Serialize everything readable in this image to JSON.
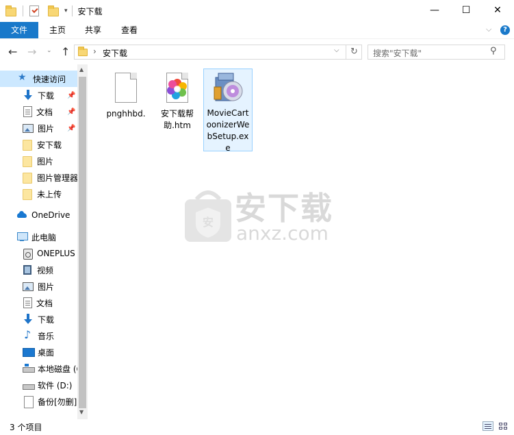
{
  "window": {
    "title": "安下载",
    "controls": {
      "minimize": "—",
      "maximize": "☐",
      "close": "✕"
    }
  },
  "ribbon": {
    "tabs": [
      {
        "label": "文件",
        "active": true
      },
      {
        "label": "主页"
      },
      {
        "label": "共享"
      },
      {
        "label": "查看"
      }
    ],
    "expand_icon": "chevron-down-icon",
    "help_icon": "help-icon"
  },
  "address": {
    "breadcrumb_sep": "›",
    "path": "安下载",
    "search_placeholder": "搜索\"安下载\""
  },
  "sidebar": {
    "items": [
      {
        "label": "快速访问",
        "icon": "star-icon",
        "selected": true
      },
      {
        "label": "下载",
        "icon": "download-icon",
        "pinned": true
      },
      {
        "label": "文档",
        "icon": "document-icon",
        "pinned": true
      },
      {
        "label": "图片",
        "icon": "pictures-icon",
        "pinned": true
      },
      {
        "label": "安下载",
        "icon": "folder-icon"
      },
      {
        "label": "图片",
        "icon": "folder-icon"
      },
      {
        "label": "图片管理器",
        "icon": "folder-icon"
      },
      {
        "label": "未上传",
        "icon": "folder-icon"
      },
      {
        "label": "OneDrive",
        "icon": "cloud-icon"
      },
      {
        "label": "此电脑",
        "icon": "computer-icon"
      },
      {
        "label": "ONEPLUS",
        "icon": "device-icon"
      },
      {
        "label": "视频",
        "icon": "video-icon"
      },
      {
        "label": "图片",
        "icon": "pictures-icon"
      },
      {
        "label": "文档",
        "icon": "document-icon"
      },
      {
        "label": "下载",
        "icon": "download-icon"
      },
      {
        "label": "音乐",
        "icon": "music-icon"
      },
      {
        "label": "桌面",
        "icon": "desktop-icon"
      },
      {
        "label": "本地磁盘 (C:)",
        "icon": "drive-icon"
      },
      {
        "label": "软件 (D:)",
        "icon": "drive-icon"
      },
      {
        "label": "备份[勿删]",
        "icon": "file-icon"
      }
    ]
  },
  "files": [
    {
      "name": "pnghhbd.",
      "icon": "blank-file-icon"
    },
    {
      "name": "安下载帮助.htm",
      "icon": "html-file-icon"
    },
    {
      "name": "MovieCartoonizerWebSetup.exe",
      "icon": "installer-icon",
      "selected": true
    }
  ],
  "watermark": {
    "text_cn": "安下载",
    "text_en": "anxz.com",
    "badge": "安"
  },
  "status": {
    "item_count": "3 个项目"
  },
  "colors": {
    "accent": "#1979ca",
    "selection": "#cce8ff",
    "selected_file_border": "#99d1ff"
  }
}
